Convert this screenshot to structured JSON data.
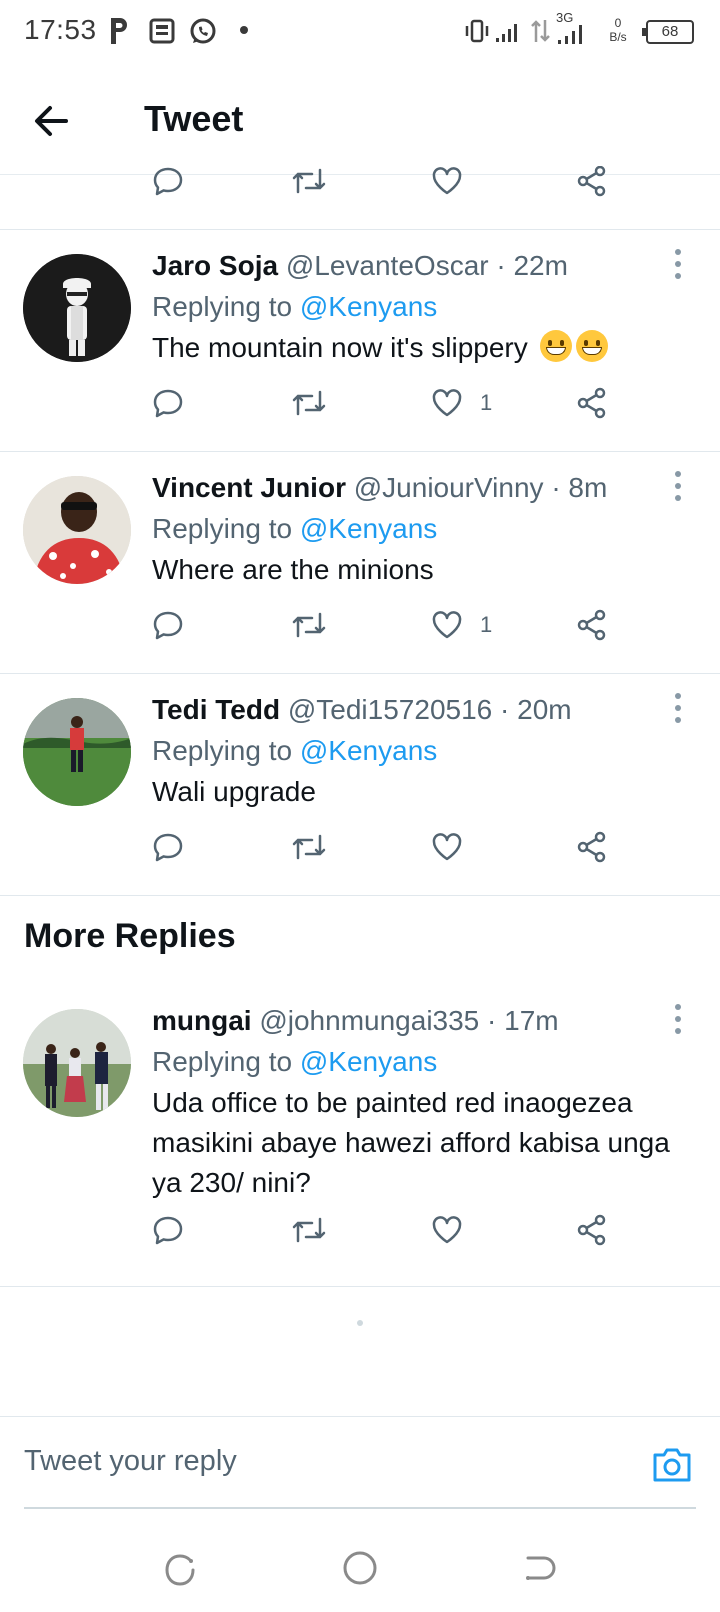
{
  "status_bar": {
    "time": "17:53",
    "network_type": "3G",
    "data_speed_value": "0",
    "data_speed_unit": "B/s",
    "battery": "68"
  },
  "header": {
    "title": "Tweet",
    "back_icon": "arrow-left-icon"
  },
  "colors": {
    "accent": "#1d9bf0",
    "text_primary": "#0f1419",
    "text_secondary": "#536471",
    "divider": "#e1e8ed"
  },
  "tweets": [
    {
      "name": "Jaro Soja",
      "handle": "@LevanteOscar",
      "time": "· 22m",
      "replying_prefix": "Replying to",
      "replying_to": "@Kenyans",
      "text": "The mountain now it's slippery",
      "emoji": "grinning-face-with-smiling-eyes",
      "likes": "1"
    },
    {
      "name": "Vincent Junior",
      "handle": "@JuniourVinny",
      "time": "· 8m",
      "replying_prefix": "Replying to",
      "replying_to": "@Kenyans",
      "text": "Where are the minions",
      "likes": "1"
    },
    {
      "name": "Tedi Tedd",
      "handle": "@Tedi15720516",
      "time": "· 20m",
      "replying_prefix": "Replying to",
      "replying_to": "@Kenyans",
      "text": "Wali upgrade",
      "likes": ""
    }
  ],
  "more_replies": {
    "title": "More Replies",
    "tweets": [
      {
        "name": "mungai",
        "handle": "@johnmungai335",
        "time": "· 17m",
        "replying_prefix": "Replying to",
        "replying_to": "@Kenyans",
        "text": "Uda office to be painted red inaogezea masikini abaye hawezi afford kabisa unga ya 230/ nini?",
        "likes": ""
      }
    ]
  },
  "reply_bar": {
    "placeholder": "Tweet your reply",
    "camera_icon": "camera-icon"
  },
  "nav_bar": {
    "recents_icon": "recents-icon",
    "home_icon": "home-icon",
    "back_icon": "nav-back-icon"
  }
}
